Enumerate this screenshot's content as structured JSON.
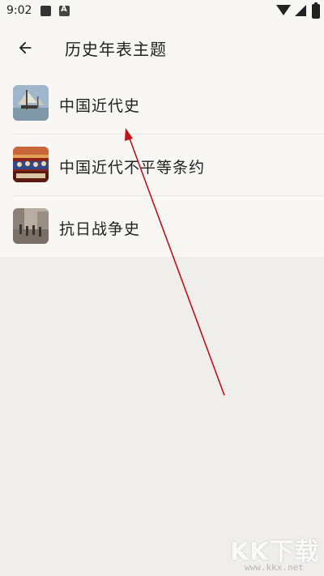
{
  "status_bar": {
    "time": "9:02"
  },
  "header": {
    "title": "历史年表主题"
  },
  "list": {
    "items": [
      {
        "label": "中国近代史",
        "thumbnail": "sailing-ships-painting"
      },
      {
        "label": "中国近代不平等条约",
        "thumbnail": "treaty-signing-painting"
      },
      {
        "label": "抗日战争史",
        "thumbnail": "war-photo"
      }
    ]
  },
  "watermark": {
    "logo": "KK下载",
    "url": "www.kkx.net"
  },
  "colors": {
    "background": "#efeeea",
    "surface": "#f8f7f3",
    "arrow": "#c0121a"
  }
}
